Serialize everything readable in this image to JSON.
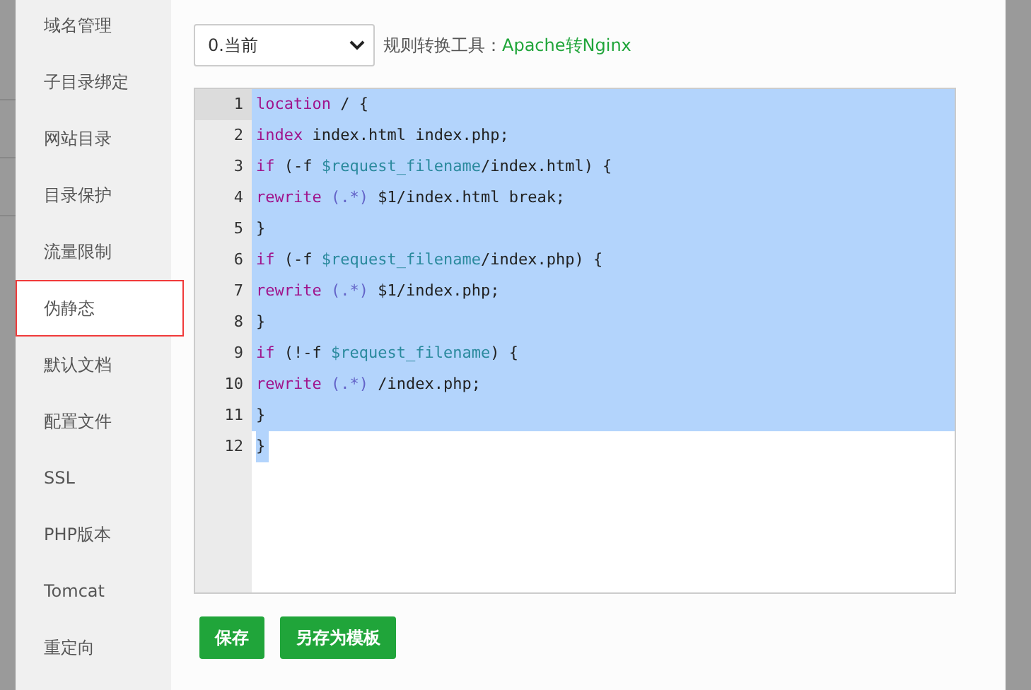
{
  "sidebar": {
    "items": [
      {
        "label": "域名管理",
        "selected": false
      },
      {
        "label": "子目录绑定",
        "selected": false
      },
      {
        "label": "网站目录",
        "selected": false
      },
      {
        "label": "目录保护",
        "selected": false
      },
      {
        "label": "流量限制",
        "selected": false
      },
      {
        "label": "伪静态",
        "selected": true
      },
      {
        "label": "默认文档",
        "selected": false
      },
      {
        "label": "配置文件",
        "selected": false
      },
      {
        "label": "SSL",
        "selected": false
      },
      {
        "label": "PHP版本",
        "selected": false
      },
      {
        "label": "Tomcat",
        "selected": false
      },
      {
        "label": "重定向",
        "selected": false
      }
    ]
  },
  "template_select": {
    "value": "0.当前"
  },
  "converter": {
    "label": "规则转换工具：",
    "link": "Apache转Nginx"
  },
  "editor": {
    "lines": [
      {
        "number": "1",
        "active": true,
        "selected": true,
        "tokens": [
          {
            "kind": "keyword",
            "text": "location"
          },
          {
            "kind": "plain",
            "text": " / {"
          }
        ]
      },
      {
        "number": "2",
        "active": false,
        "selected": true,
        "tokens": [
          {
            "kind": "keyword",
            "text": "index"
          },
          {
            "kind": "plain",
            "text": " index.html index.php;"
          }
        ]
      },
      {
        "number": "3",
        "active": false,
        "selected": true,
        "tokens": [
          {
            "kind": "keyword",
            "text": "if"
          },
          {
            "kind": "plain",
            "text": " (-f "
          },
          {
            "kind": "variable",
            "text": "$request_filename"
          },
          {
            "kind": "plain",
            "text": "/index.html) {"
          }
        ]
      },
      {
        "number": "4",
        "active": false,
        "selected": true,
        "tokens": [
          {
            "kind": "keyword",
            "text": "rewrite"
          },
          {
            "kind": "regex",
            "text": " (.*)"
          },
          {
            "kind": "plain",
            "text": " $1/index.html break;"
          }
        ]
      },
      {
        "number": "5",
        "active": false,
        "selected": true,
        "tokens": [
          {
            "kind": "plain",
            "text": "}"
          }
        ]
      },
      {
        "number": "6",
        "active": false,
        "selected": true,
        "tokens": [
          {
            "kind": "keyword",
            "text": "if"
          },
          {
            "kind": "plain",
            "text": " (-f "
          },
          {
            "kind": "variable",
            "text": "$request_filename"
          },
          {
            "kind": "plain",
            "text": "/index.php) {"
          }
        ]
      },
      {
        "number": "7",
        "active": false,
        "selected": true,
        "tokens": [
          {
            "kind": "keyword",
            "text": "rewrite"
          },
          {
            "kind": "regex",
            "text": " (.*)"
          },
          {
            "kind": "plain",
            "text": " $1/index.php;"
          }
        ]
      },
      {
        "number": "8",
        "active": false,
        "selected": true,
        "tokens": [
          {
            "kind": "plain",
            "text": "}"
          }
        ]
      },
      {
        "number": "9",
        "active": false,
        "selected": true,
        "tokens": [
          {
            "kind": "keyword",
            "text": "if"
          },
          {
            "kind": "plain",
            "text": " (!-f "
          },
          {
            "kind": "variable",
            "text": "$request_filename"
          },
          {
            "kind": "plain",
            "text": ") {"
          }
        ]
      },
      {
        "number": "10",
        "active": false,
        "selected": true,
        "tokens": [
          {
            "kind": "keyword",
            "text": "rewrite"
          },
          {
            "kind": "regex",
            "text": " (.*)"
          },
          {
            "kind": "plain",
            "text": " /index.php;"
          }
        ]
      },
      {
        "number": "11",
        "active": false,
        "selected": true,
        "tokens": [
          {
            "kind": "plain",
            "text": "}"
          }
        ]
      },
      {
        "number": "12",
        "active": false,
        "selected": true,
        "tokens": [
          {
            "kind": "plain",
            "text": "}"
          }
        ]
      }
    ]
  },
  "buttons": [
    "保存",
    "另存为模板"
  ]
}
